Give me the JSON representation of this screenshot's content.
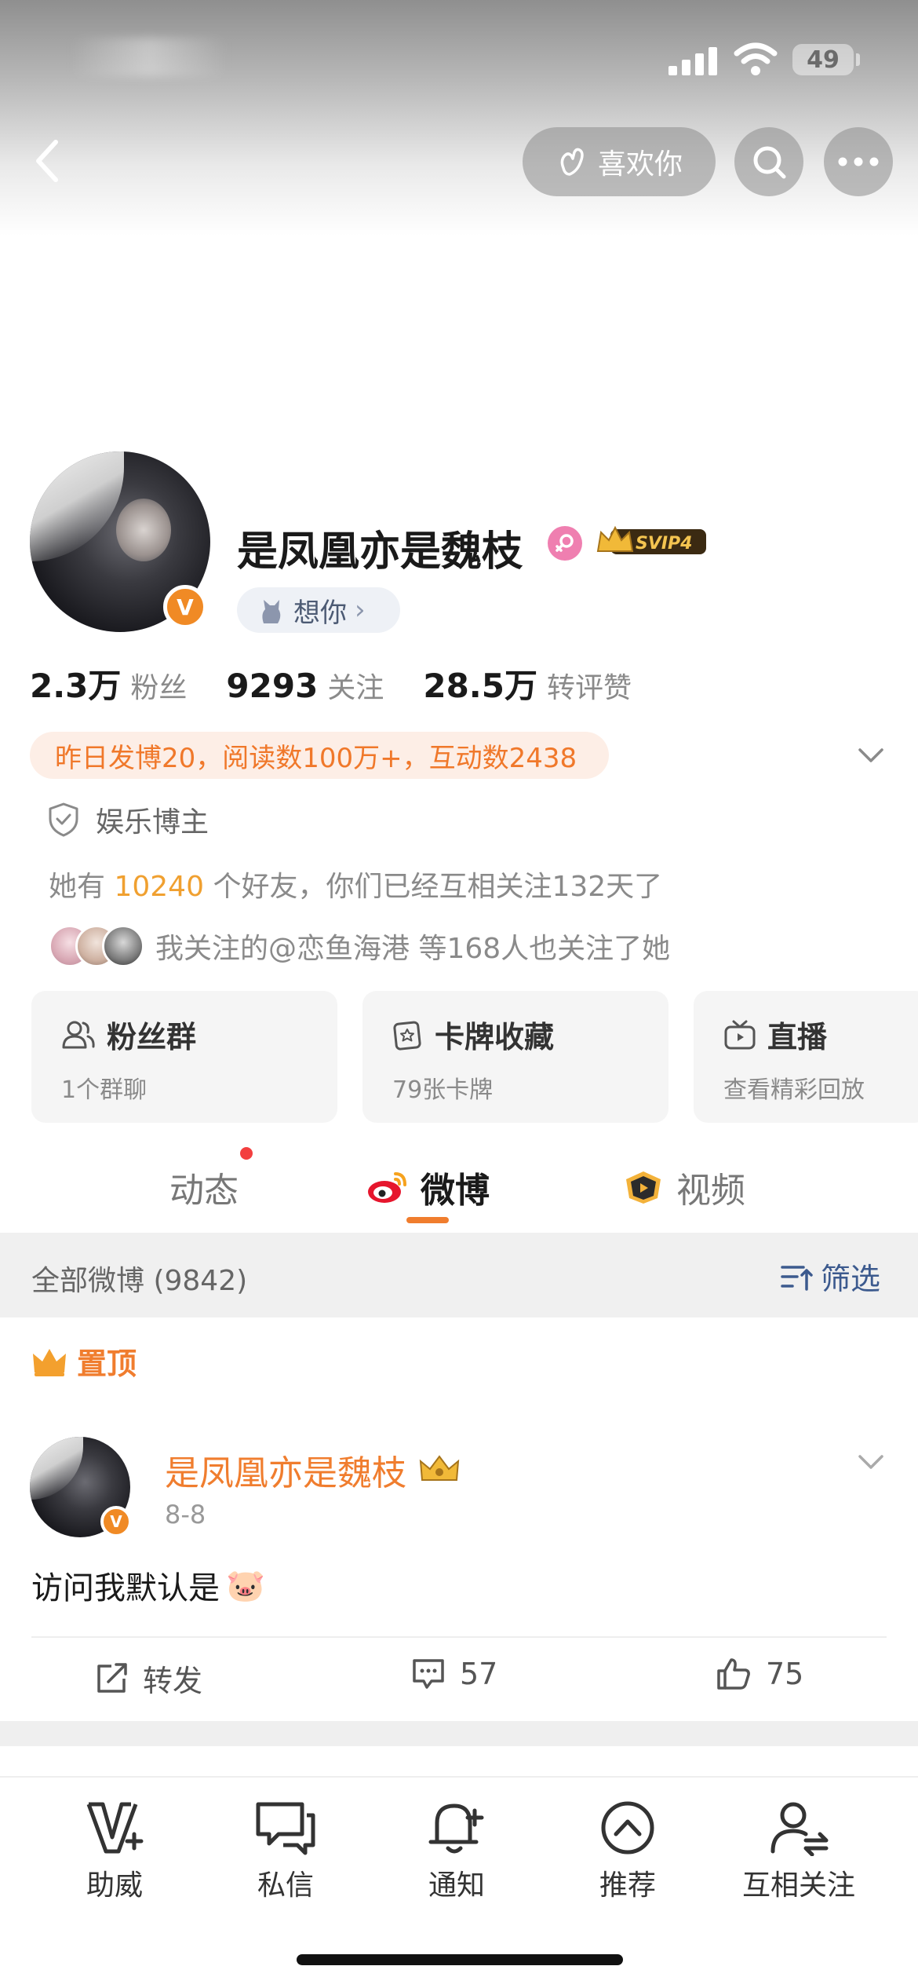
{
  "status_bar": {
    "battery": "49"
  },
  "header": {
    "like_label": "喜欢你"
  },
  "profile": {
    "name": "是凤凰亦是魏枝",
    "svip": "SVIP4",
    "miss_label": "想你",
    "miss_chevron": "›",
    "verified_mark": "V",
    "stats": [
      {
        "value": "2.3万",
        "label": "粉丝"
      },
      {
        "value": "9293",
        "label": "关注"
      },
      {
        "value": "28.5万",
        "label": "转评赞"
      }
    ],
    "daily_summary": "昨日发博20，阅读数100万+，互动数2438",
    "category": "娱乐博主",
    "friends_prefix": "她有",
    "friends_count": "10240",
    "friends_suffix": "个好友，你们已经互相关注132天了",
    "mutual_follow_text": "我关注的@恋鱼海港 等168人也关注了她"
  },
  "cards": [
    {
      "title": "粉丝群",
      "sub": "1个群聊",
      "icon": "group-icon"
    },
    {
      "title": "卡牌收藏",
      "sub": "79张卡牌",
      "icon": "card-icon"
    },
    {
      "title": "直播",
      "sub": "查看精彩回放",
      "icon": "tv-icon"
    }
  ],
  "tabs": [
    {
      "label": "动态",
      "active": false,
      "has_dot": true
    },
    {
      "label": "微博",
      "active": true
    },
    {
      "label": "视频",
      "active": false
    }
  ],
  "filter": {
    "count_label": "全部微博 (9842)",
    "filter_label": "筛选"
  },
  "pinned": {
    "label": "置顶"
  },
  "post": {
    "author": "是凤凰亦是魏枝",
    "date": "8-8",
    "text": "访问我默认是",
    "emoji": "🐷",
    "actions": {
      "repost": "转发",
      "comments": "57",
      "likes": "75"
    }
  },
  "bottom_nav": [
    {
      "label": "助威",
      "icon": "cheer-icon"
    },
    {
      "label": "私信",
      "icon": "message-icon"
    },
    {
      "label": "通知",
      "icon": "bell-icon"
    },
    {
      "label": "推荐",
      "icon": "recommend-icon"
    },
    {
      "label": "互相关注",
      "icon": "mutual-follow-icon"
    }
  ],
  "colors": {
    "accent": "#f07d2e",
    "link_blue": "#3c5a8e",
    "daily_pill_bg": "#fdeee6"
  }
}
